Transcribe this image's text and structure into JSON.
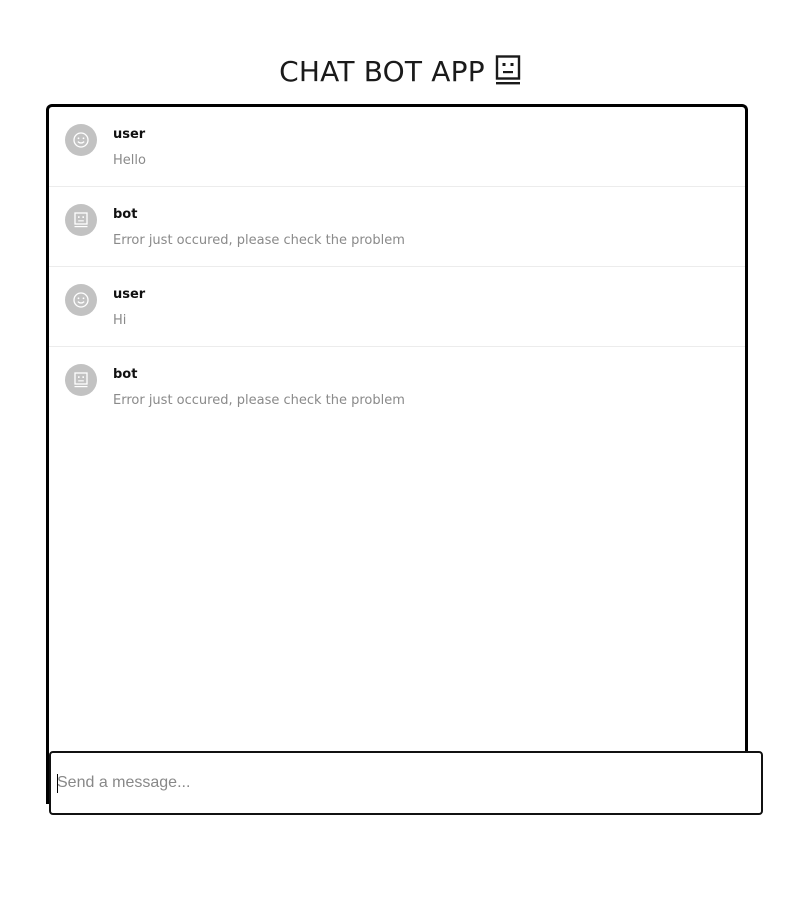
{
  "app": {
    "title": "CHAT BOT APP",
    "title_icon": "robot-face-icon"
  },
  "messages": [
    {
      "sender": "user",
      "text": "Hello",
      "avatar_icon": "smiley-icon"
    },
    {
      "sender": "bot",
      "text": "Error just occured, please check the problem",
      "avatar_icon": "robot-icon"
    },
    {
      "sender": "user",
      "text": "Hi",
      "avatar_icon": "smiley-icon"
    },
    {
      "sender": "bot",
      "text": "Error just occured, please check the problem",
      "avatar_icon": "robot-icon"
    }
  ],
  "composer": {
    "placeholder": "Send a message...",
    "value": ""
  },
  "colors": {
    "avatar_bg": "#c2c2c2",
    "border": "#000000",
    "message_text": "#8a8a8a"
  }
}
